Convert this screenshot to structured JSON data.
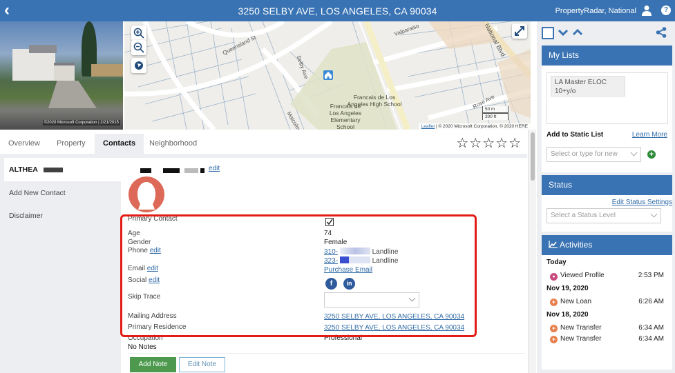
{
  "header": {
    "title": "3250 SELBY AVE, LOS ANGELES, CA 90034",
    "account": "PropertyRadar, National",
    "back_icon": "chevron-left-icon",
    "user_icon": "user-icon",
    "help_icon": "help-icon"
  },
  "photo": {
    "credit": "©2020 Microsoft Corporation | 2/21/2015"
  },
  "map": {
    "street_labels": [
      "Queensland St",
      "Selby Ave",
      "Valparaiso",
      "National Blvd",
      "Rose Ave",
      "Malcolm"
    ],
    "school_high": "Francais de Los Angeles High School",
    "school_elementary": "Francais de Los Angeles Elementary School",
    "scale_m": "50 m",
    "scale_ft": "300 ft",
    "attribution_link": "Leaflet",
    "attribution_text": "| © 2020 Microsoft Corporation, © 2020 HERE",
    "controls": [
      "zoom-in",
      "zoom-out",
      "globe",
      "fullscreen"
    ]
  },
  "tabs": [
    {
      "label": "Overview",
      "active": false
    },
    {
      "label": "Property",
      "active": false
    },
    {
      "label": "Contacts",
      "active": true
    },
    {
      "label": "Neighborhood",
      "active": false
    }
  ],
  "rating": {
    "stars_filled": 0,
    "stars_total": 5
  },
  "sidebar": {
    "items": [
      {
        "label": "ALTHEA",
        "active": true
      },
      {
        "label": "Add New Contact",
        "active": false
      },
      {
        "label": "Disclaimer",
        "active": false
      }
    ]
  },
  "contact": {
    "edit_label": "edit",
    "fields": {
      "primary_contact": {
        "label": "Primary Contact",
        "checked": true
      },
      "age": {
        "label": "Age",
        "value": "74"
      },
      "gender": {
        "label": "Gender",
        "value": "Female"
      },
      "phone": {
        "label": "Phone",
        "edit": "edit",
        "numbers": [
          {
            "number": "310-",
            "type": "Landline"
          },
          {
            "number": "323-",
            "type": "Landline"
          }
        ]
      },
      "email": {
        "label": "Email",
        "edit": "edit",
        "value": "Purchase Email"
      },
      "social": {
        "label": "Social",
        "edit": "edit",
        "networks": [
          "facebook",
          "linkedin"
        ]
      },
      "skip_trace": {
        "label": "Skip Trace",
        "value": ""
      },
      "mailing_address": {
        "label": "Mailing Address",
        "value": "3250 SELBY AVE, LOS ANGELES, CA 90034"
      },
      "primary_residence": {
        "label": "Primary Residence",
        "value": "3250 SELBY AVE, LOS ANGELES, CA 90034"
      },
      "occupation": {
        "label": "Occupation",
        "value": "Professional"
      }
    },
    "notes": "No Notes",
    "add_note": "Add Note",
    "edit_note": "Edit Note"
  },
  "right_panel": {
    "my_lists": {
      "title": "My Lists",
      "items": [
        "LA Master ELOC 10+y/o"
      ],
      "add_static_label": "Add to Static List",
      "learn_more": "Learn More",
      "select_placeholder": "Select or type for new"
    },
    "status": {
      "title": "Status",
      "edit_settings": "Edit Status Settings",
      "select_placeholder": "Select a Status Level"
    },
    "activities": {
      "title": "Activities",
      "groups": [
        {
          "day": "Today",
          "items": [
            {
              "label": "Viewed Profile",
              "time": "2:53 PM",
              "icon": "eye-icon"
            }
          ]
        },
        {
          "day": "Nov 19, 2020",
          "items": [
            {
              "label": "New Loan",
              "time": "6:26 AM",
              "icon": "plus-circle-icon"
            }
          ]
        },
        {
          "day": "Nov 18, 2020",
          "items": [
            {
              "label": "New Transfer",
              "time": "6:34 AM",
              "icon": "plus-circle-icon"
            },
            {
              "label": "New Transfer",
              "time": "6:34 AM",
              "icon": "plus-circle-icon"
            }
          ]
        }
      ]
    }
  },
  "colors": {
    "brand": "#3973b3",
    "highlight": "#e31b14",
    "add_note": "#4d9a4f",
    "avatar": "#dd6a58",
    "activity_plus": "#e8804e",
    "activity_eye": "#c84a7e"
  }
}
